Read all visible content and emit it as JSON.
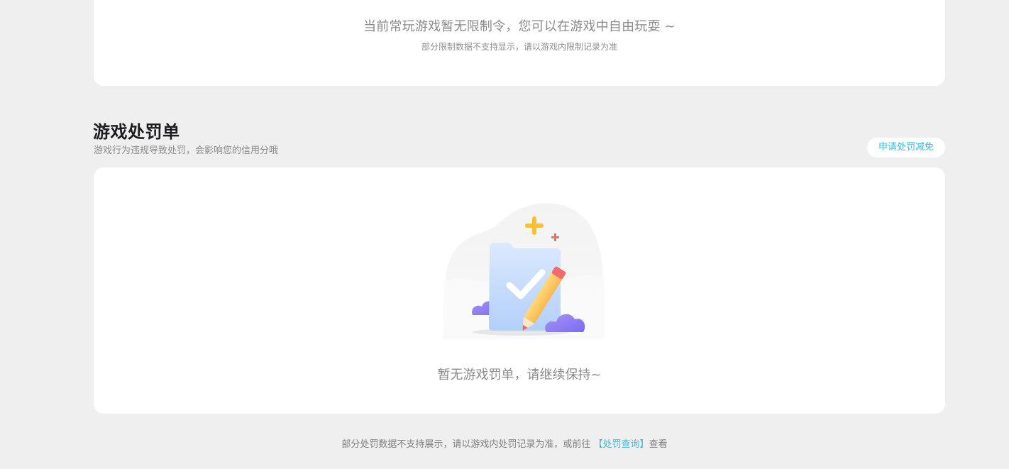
{
  "restriction": {
    "main_text": "当前常玩游戏暂无限制令，您可以在游戏中自由玩耍 ~",
    "sub_text": "部分限制数据不支持显示，请以游戏内限制记录为准"
  },
  "penalty": {
    "title": "游戏处罚单",
    "description": "游戏行为违规导致处罚，会影响您的信用分哦",
    "apply_button": "申请处罚减免",
    "empty_text": "暂无游戏罚单，请继续保持~"
  },
  "footer": {
    "text_before": "部分处罚数据不支持展示，请以游戏内处罚记录为准，或前往 ",
    "link_text": "【处罚查询】",
    "text_after": "查看"
  },
  "colors": {
    "accent": "#3fb8d9",
    "background": "#efefef",
    "card": "#ffffff"
  }
}
